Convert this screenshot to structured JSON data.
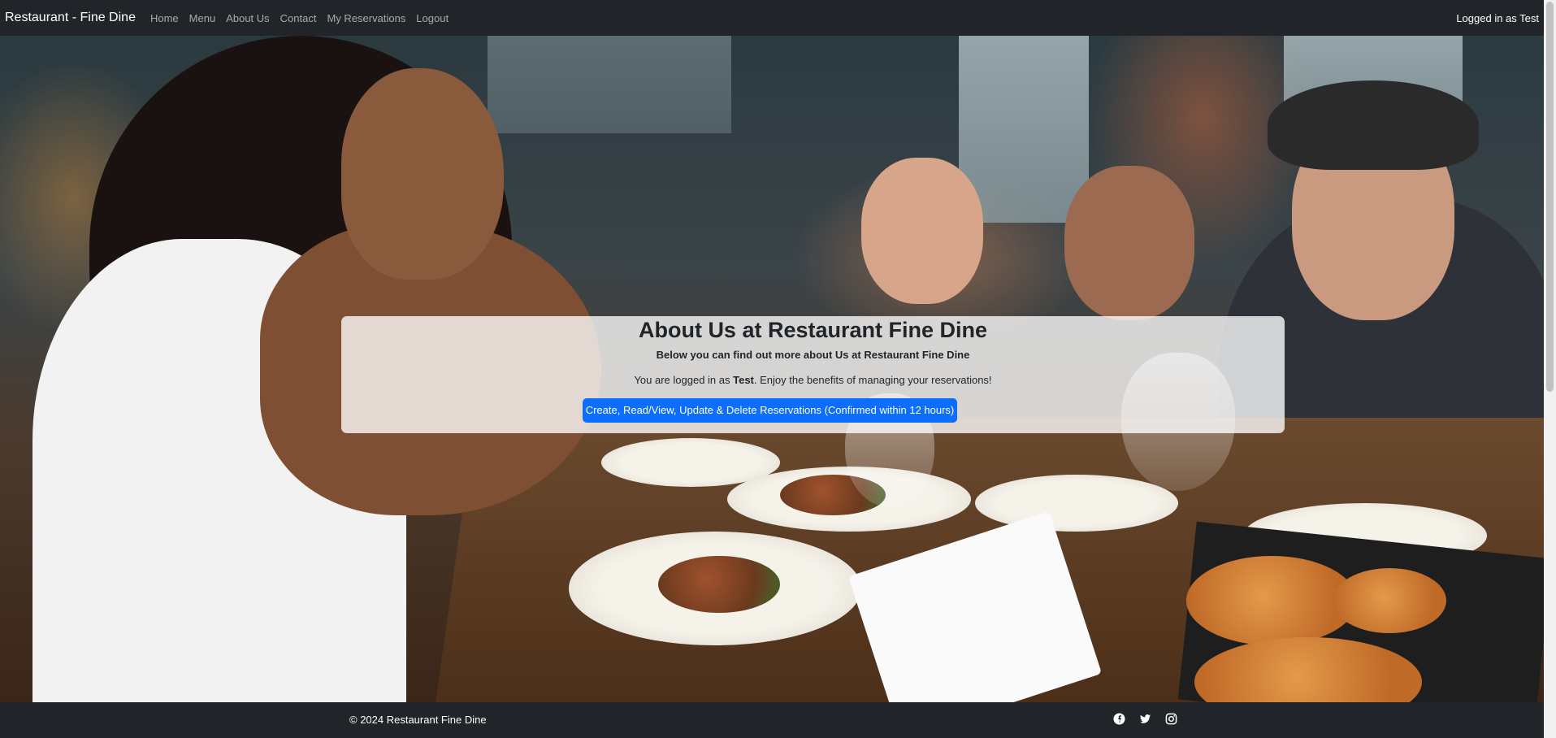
{
  "navbar": {
    "brand": "Restaurant - Fine Dine",
    "links": [
      "Home",
      "Menu",
      "About Us",
      "Contact",
      "My Reservations",
      "Logout"
    ],
    "user_status": "Logged in as Test"
  },
  "about": {
    "title": "About Us at Restaurant Fine Dine",
    "subtitle": "Below you can find out more about Us at Restaurant Fine Dine",
    "status_prefix": "You are logged in as ",
    "username": "Test",
    "status_suffix": ". Enjoy the benefits of managing your reservations!",
    "cta_label": "Create, Read/View, Update & Delete Reservations (Confirmed within 12 hours)"
  },
  "footer": {
    "copyright": "© 2024 Restaurant Fine Dine",
    "social_icons": [
      "facebook-icon",
      "twitter-icon",
      "instagram-icon"
    ]
  },
  "colors": {
    "navbar_bg": "#212529",
    "primary_button": "#0d6efd",
    "panel_bg": "rgba(255,255,255,0.78)"
  }
}
